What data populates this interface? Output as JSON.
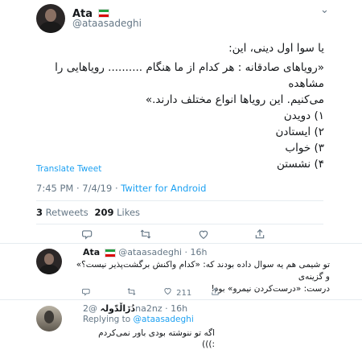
{
  "main_tweet": {
    "display_name": "Ata",
    "handle": "@ataasadeghi",
    "more": "⌄",
    "lines": [
      "یا سوا اول دینی، این:",
      "«رویاهای صادقانه : هر کدام از ما هنگام .......... رویاهایی را مشاهده",
      "می‌کنیم. این رویاها انواع مختلف دارند.»",
      "۱) دویدن",
      "۲) ایستادن",
      "۳) خواب",
      "۴) نشستن"
    ],
    "translate": "Translate Tweet",
    "time": "7:45 PM · 7/4/19 · ",
    "source": "Twitter for Android",
    "retweets_count": "3",
    "retweets_label": "Retweets",
    "likes_count": "209",
    "likes_label": "Likes"
  },
  "reply1": {
    "display_name": "Ata",
    "handle": "@ataasadeghi · 16h",
    "lines": [
      "تو شیمی هم یه سوال داده بودند که: «کدام واکنش برگشت‌پذیر نیست؟» و گزینه‌ی",
      "درست: «درست‌کردن نیمرو» بود!"
    ],
    "likes": "211"
  },
  "reply2": {
    "display_name": "دُڒاڵدّولہ",
    "handle": "@2na2nz · 16h",
    "replying_prefix": "Replying to ",
    "replying_handle": "@ataasadeghi",
    "text": "اگه تو ننوشته بودی باور نمی‌کردم :)))"
  },
  "icons": {
    "reply": "reply-icon",
    "retweet": "retweet-icon",
    "like": "heart-icon",
    "share": "share-icon",
    "more": "chevron-down-icon"
  }
}
